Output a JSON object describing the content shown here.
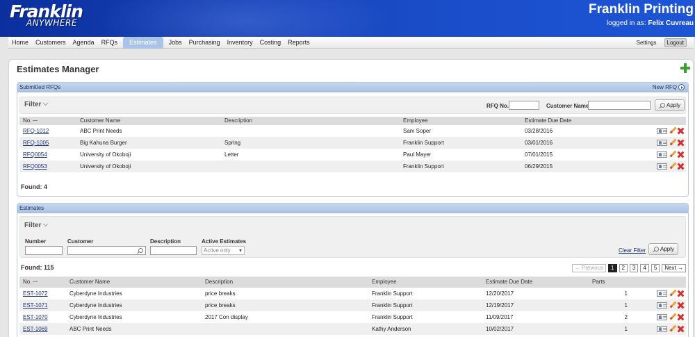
{
  "header": {
    "logo_main": "Franklin",
    "logo_sub": "ANYWHERE",
    "company": "Franklin Printing",
    "logged_in_prefix": "logged in as: ",
    "user": "Felix Cuvreau"
  },
  "nav": {
    "items": [
      "Home",
      "Customers",
      "Agenda",
      "RFQs",
      "Estimates",
      "Jobs",
      "Purchasing",
      "Inventory",
      "Costing",
      "Reports"
    ],
    "active": "Estimates",
    "settings": "Settings",
    "logout": "Logout"
  },
  "page": {
    "title": "Estimates Manager"
  },
  "rfqs": {
    "panel_title": "Submitted RFQs",
    "new_link": "New RFQ",
    "filter_title": "Filter",
    "rfq_no_label": "RFQ No.",
    "customer_name_label": "Customer Name",
    "apply": "Apply",
    "columns": [
      "No.",
      "Customer Name",
      "Description",
      "Employee",
      "Estimate Due Date"
    ],
    "rows": [
      {
        "no": "RFQ-1012",
        "customer": "ABC Print Needs",
        "desc": "",
        "employee": "Sam Soper",
        "due": "03/28/2016"
      },
      {
        "no": "RFQ-1005",
        "customer": "Big Kahuna Burger",
        "desc": "Spring",
        "employee": "Franklin Support",
        "due": "03/01/2016"
      },
      {
        "no": "RFQ0054",
        "customer": "University of Okoboji",
        "desc": "Letter",
        "employee": "Paul Mayer",
        "due": "07/01/2015"
      },
      {
        "no": "RFQ0053",
        "customer": "University of Okoboji",
        "desc": "",
        "employee": "Franklin Support",
        "due": "06/29/2015"
      }
    ],
    "found": "Found: 4"
  },
  "estimates": {
    "panel_title": "Estimates",
    "filter_title": "Filter",
    "number_label": "Number",
    "customer_label": "Customer",
    "description_label": "Description",
    "active_label": "Active Estimates",
    "active_value": "Active only",
    "clear_filter": "Clear Filter",
    "apply": "Apply",
    "found": "Found: 115",
    "pager": {
      "prev": "← Previous",
      "pages": [
        "1",
        "2",
        "3",
        "4",
        "5"
      ],
      "current": "1",
      "next": "Next →"
    },
    "columns": [
      "No.",
      "Customer Name",
      "Description",
      "Employee",
      "Estimate Due Date",
      "Parts"
    ],
    "rows": [
      {
        "no": "EST-1072",
        "customer": "Cyberdyne Industries",
        "desc": "price breaks",
        "employee": "Franklin Support",
        "due": "12/20/2017",
        "parts": "1"
      },
      {
        "no": "EST-1071",
        "customer": "Cyberdyne Industries",
        "desc": "price breaks",
        "employee": "Franklin Support",
        "due": "12/19/2017",
        "parts": "1"
      },
      {
        "no": "EST-1070",
        "customer": "Cyberdyne Industries",
        "desc": "2017 Con display",
        "employee": "Franklin Support",
        "due": "11/09/2017",
        "parts": "2"
      },
      {
        "no": "EST-1069",
        "customer": "ABC Print Needs",
        "desc": "",
        "employee": "Kathy Anderson",
        "due": "10/02/2017",
        "parts": "1"
      }
    ]
  },
  "colors": {
    "accent": "#a9c4e6",
    "header_bg": "#153fb3",
    "add": "#3aa02e",
    "delete": "#d4302b"
  }
}
